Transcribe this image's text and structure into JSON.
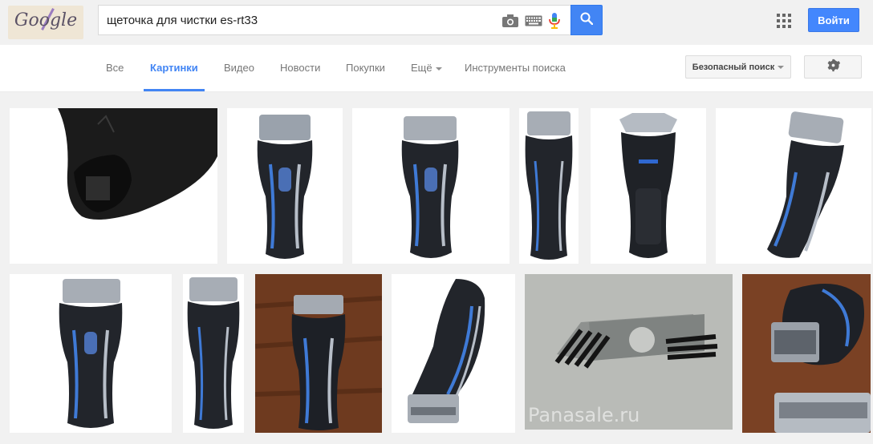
{
  "search": {
    "query": "щеточка для чистки es-rt33"
  },
  "header": {
    "login_label": "Войти"
  },
  "nav": {
    "tabs": [
      {
        "label": "Все"
      },
      {
        "label": "Картинки"
      },
      {
        "label": "Видео"
      },
      {
        "label": "Новости"
      },
      {
        "label": "Покупки"
      },
      {
        "label": "Ещё"
      },
      {
        "label": "Инструменты поиска"
      }
    ],
    "safe_search_label": "Безопасный поиск"
  },
  "results": {
    "watermark": "Panasale.ru"
  },
  "icons": [
    "camera-icon",
    "keyboard-icon",
    "microphone-icon",
    "search-icon",
    "apps-grid-icon",
    "gear-icon"
  ],
  "colors": {
    "accent": "#4285f4",
    "login": "#4387fd"
  }
}
